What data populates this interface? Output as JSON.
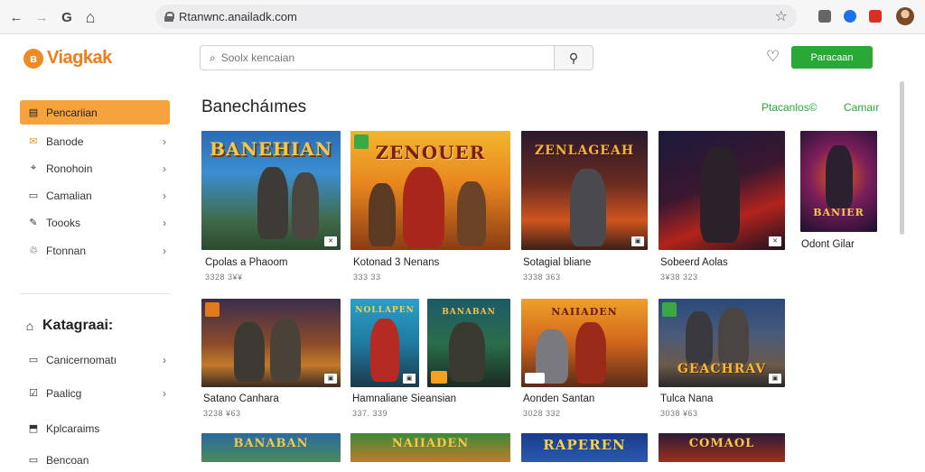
{
  "browser": {
    "url": "Rtanwnc.anailadk.com",
    "back": "←",
    "forward": "→",
    "reload": "G",
    "home": "⌂",
    "star": "☆"
  },
  "header": {
    "logo_mark": "ʙ",
    "logo_text": "Viagkak",
    "search_placeholder": "Soolx kencaian",
    "cta_label": "Paracaan"
  },
  "sidebar": {
    "items": [
      {
        "label": "Pencariian",
        "icon": "▤",
        "active": true
      },
      {
        "label": "Banode",
        "icon": "✉",
        "active": false
      },
      {
        "label": "Ronohoin",
        "icon": "⌖",
        "active": false
      },
      {
        "label": "Camalian",
        "icon": "▭",
        "active": false
      },
      {
        "label": "Toooks",
        "icon": "✎",
        "active": false
      },
      {
        "label": "Ftonnan",
        "icon": "♲",
        "active": false
      }
    ],
    "section_title": "Katagraai:",
    "section_icon": "⌂",
    "section_items": [
      {
        "label": "Canicernomatı",
        "icon": "▭"
      },
      {
        "label": "Paalicg",
        "icon": "☑"
      },
      {
        "label": "Kplcaraims",
        "icon": "⬒"
      },
      {
        "label": "Bencoan",
        "icon": "▭"
      }
    ]
  },
  "main": {
    "title": "Banecháımes",
    "tab_1": "Ptacanlos©",
    "tab_2": "Camaır"
  },
  "cards": [
    {
      "art": "BANEHIAN",
      "title": "Cpolas a Phaoom",
      "meta": "3328 3¥¥"
    },
    {
      "art": "ZENOUER",
      "title": "Kotonad 3 Nenans",
      "meta": "333 33"
    },
    {
      "art": "ZENLAGEAH",
      "title": "Sotagial bliane",
      "meta": "3338 363"
    },
    {
      "art": "",
      "title": "Sobeerd Aolas",
      "meta": "3¥38 323"
    },
    {
      "art": "BANIER",
      "title": "Odont Gilar",
      "meta": ""
    },
    {
      "art": "",
      "title": "Satano Canhara",
      "meta": "3238 ¥63"
    },
    {
      "art": "NOLLAPEN",
      "title": "Hamnaliane Sieansian",
      "meta": "337. 339"
    },
    {
      "art": "",
      "title": "Aonden Santan",
      "meta": "3028 332"
    },
    {
      "art": "GEACHRAV",
      "title": "Tulca Nana",
      "meta": "3038 ¥63"
    },
    {
      "art": "BANABAN",
      "title": "",
      "meta": ""
    },
    {
      "art": "NAIIADEN",
      "title": "",
      "meta": ""
    },
    {
      "art": "RAPEREN",
      "title": "",
      "meta": ""
    },
    {
      "art": "COMAOL",
      "title": "",
      "meta": ""
    }
  ]
}
